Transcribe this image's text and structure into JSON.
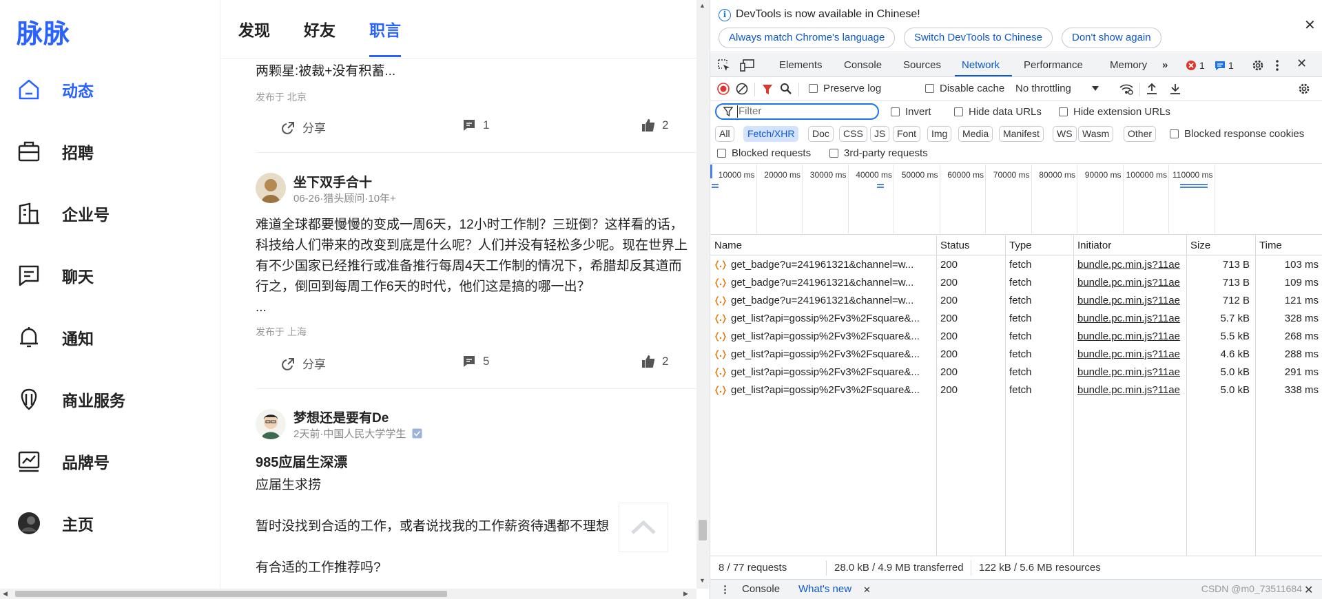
{
  "app": {
    "logo": "脉脉",
    "nav": [
      {
        "label": "动态",
        "icon": "home-icon",
        "active": true
      },
      {
        "label": "招聘",
        "icon": "briefcase-icon"
      },
      {
        "label": "企业号",
        "icon": "building-icon"
      },
      {
        "label": "聊天",
        "icon": "chat-icon"
      },
      {
        "label": "通知",
        "icon": "bell-icon"
      },
      {
        "label": "商业服务",
        "icon": "business-icon"
      },
      {
        "label": "品牌号",
        "icon": "chart-icon"
      },
      {
        "label": "主页",
        "icon": "avatar-icon"
      }
    ],
    "tabs": [
      {
        "label": "发现"
      },
      {
        "label": "好友"
      },
      {
        "label": "职言",
        "active": true
      }
    ],
    "posts": [
      {
        "text": "两颗星:被裁+没有积蓄...",
        "location": "发布于 北京",
        "share": "分享",
        "comments": "1",
        "likes": "2"
      },
      {
        "author": "坐下双手合十",
        "sub": "06-26·猎头顾问·10年+",
        "text": "难道全球都要慢慢的变成一周6天，12小时工作制？三班倒？这样看的话，科技给人们带来的改变到底是什么呢？人们并没有轻松多少呢。现在世界上有不少国家已经推行或准备推行每周4天工作制的情况下，希腊却反其道而行之，倒回到每周工作6天的时代，他们这是搞的哪一出？",
        "more": "...",
        "location": "发布于 上海",
        "share": "分享",
        "comments": "5",
        "likes": "2"
      },
      {
        "author": "梦想还是要有De",
        "sub": "2天前·中国人民大学学生",
        "title": "985应届生深漂",
        "line1": "应届生求捞",
        "line2": "暂时没找到合适的工作，或者说找我的工作薪资待遇都不理想",
        "line3": "有合适的工作推荐吗?"
      }
    ]
  },
  "devtools": {
    "infobar": {
      "message": "DevTools is now available in Chinese!",
      "btn1": "Always match Chrome's language",
      "btn2": "Switch DevTools to Chinese",
      "btn3": "Don't show again"
    },
    "tabs": [
      "Elements",
      "Console",
      "Sources",
      "Network",
      "Performance",
      "Memory"
    ],
    "active_tab": "Network",
    "error_count": "1",
    "message_count": "1",
    "toolbar": {
      "preserve_log": "Preserve log",
      "disable_cache": "Disable cache",
      "throttling": "No throttling"
    },
    "filter": {
      "placeholder": "Filter",
      "invert": "Invert",
      "hide_data_urls": "Hide data URLs",
      "hide_extension_urls": "Hide extension URLs"
    },
    "types": [
      "All",
      "Fetch/XHR",
      "Doc",
      "CSS",
      "JS",
      "Font",
      "Img",
      "Media",
      "Manifest",
      "WS",
      "Wasm",
      "Other"
    ],
    "active_type": "Fetch/XHR",
    "blocked_response_cookies": "Blocked response cookies",
    "blocked_requests": "Blocked requests",
    "third_party_requests": "3rd-party requests",
    "timeline_ticks": [
      "10000 ms",
      "20000 ms",
      "30000 ms",
      "40000 ms",
      "50000 ms",
      "60000 ms",
      "70000 ms",
      "80000 ms",
      "90000 ms",
      "100000 ms",
      "110000 ms"
    ],
    "columns": [
      "Name",
      "Status",
      "Type",
      "Initiator",
      "Size",
      "Time"
    ],
    "requests": [
      {
        "name": "get_badge?u=241961321&channel=w...",
        "status": "200",
        "type": "fetch",
        "initiator": "bundle.pc.min.js?11ae",
        "size": "713 B",
        "time": "103 ms"
      },
      {
        "name": "get_badge?u=241961321&channel=w...",
        "status": "200",
        "type": "fetch",
        "initiator": "bundle.pc.min.js?11ae",
        "size": "713 B",
        "time": "109 ms"
      },
      {
        "name": "get_badge?u=241961321&channel=w...",
        "status": "200",
        "type": "fetch",
        "initiator": "bundle.pc.min.js?11ae",
        "size": "712 B",
        "time": "121 ms"
      },
      {
        "name": "get_list?api=gossip%2Fv3%2Fsquare&...",
        "status": "200",
        "type": "fetch",
        "initiator": "bundle.pc.min.js?11ae",
        "size": "5.7 kB",
        "time": "328 ms"
      },
      {
        "name": "get_list?api=gossip%2Fv3%2Fsquare&...",
        "status": "200",
        "type": "fetch",
        "initiator": "bundle.pc.min.js?11ae",
        "size": "5.5 kB",
        "time": "268 ms"
      },
      {
        "name": "get_list?api=gossip%2Fv3%2Fsquare&...",
        "status": "200",
        "type": "fetch",
        "initiator": "bundle.pc.min.js?11ae",
        "size": "4.6 kB",
        "time": "288 ms"
      },
      {
        "name": "get_list?api=gossip%2Fv3%2Fsquare&...",
        "status": "200",
        "type": "fetch",
        "initiator": "bundle.pc.min.js?11ae",
        "size": "5.0 kB",
        "time": "291 ms"
      },
      {
        "name": "get_list?api=gossip%2Fv3%2Fsquare&...",
        "status": "200",
        "type": "fetch",
        "initiator": "bundle.pc.min.js?11ae",
        "size": "5.0 kB",
        "time": "338 ms"
      }
    ],
    "status": {
      "requests": "8 / 77 requests",
      "transferred": "28.0 kB / 4.9 MB transferred",
      "resources": "122 kB / 5.6 MB resources"
    },
    "drawer": {
      "console": "Console",
      "whats_new": "What's new"
    },
    "watermark": "CSDN @m0_73511684"
  }
}
